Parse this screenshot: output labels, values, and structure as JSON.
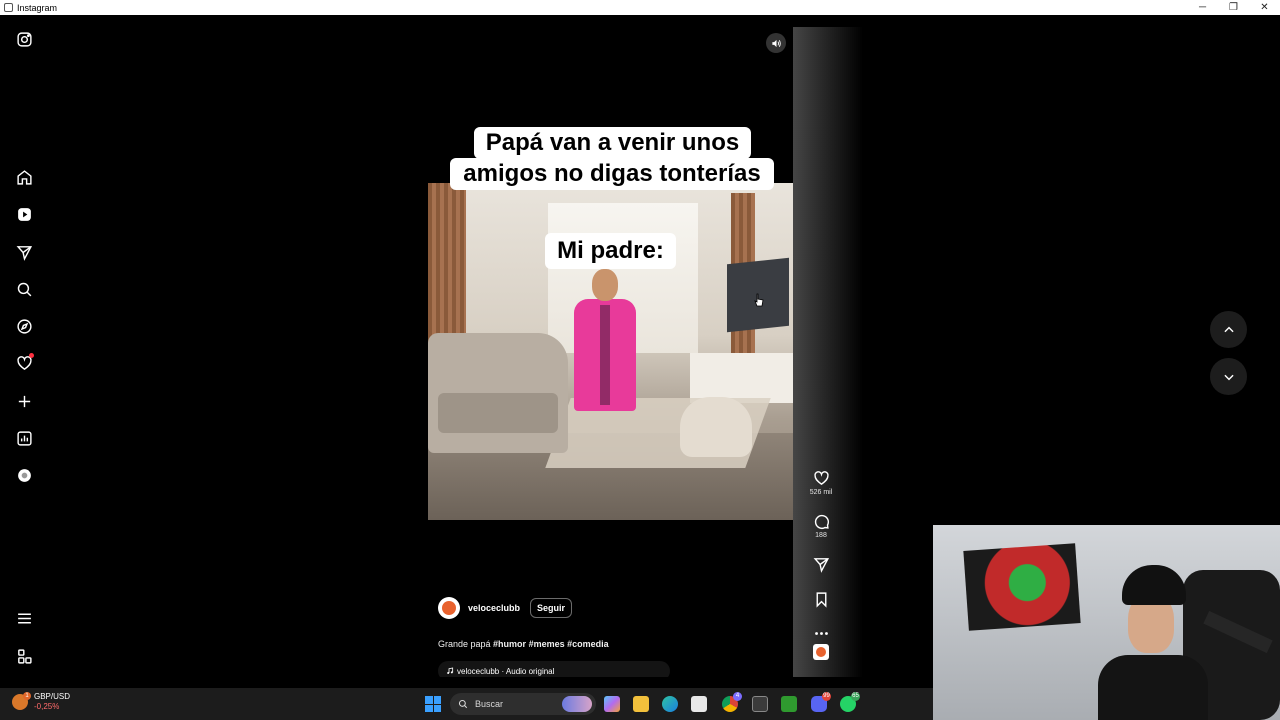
{
  "window": {
    "title": "Instagram",
    "controls": {
      "minimize": "─",
      "restore": "❐",
      "close": "✕"
    }
  },
  "sidebar": {
    "items": [
      {
        "name": "instagram-logo-icon"
      },
      {
        "name": "home-icon"
      },
      {
        "name": "reels-icon"
      },
      {
        "name": "messages-icon"
      },
      {
        "name": "search-icon"
      },
      {
        "name": "explore-icon"
      },
      {
        "name": "notifications-icon",
        "has_dot": true
      },
      {
        "name": "create-icon"
      },
      {
        "name": "dashboard-icon"
      },
      {
        "name": "meta-ai-icon"
      },
      {
        "name": "more-menu-icon"
      },
      {
        "name": "also-from-meta-icon"
      }
    ]
  },
  "reel": {
    "caption_line_1": "Papá van a venir unos",
    "caption_line_2": "amigos no digas tonterías",
    "caption_line_3": "Mi padre:",
    "author": "veloceclubb",
    "follow_label": "Seguir",
    "description_prefix": "Grande papá ",
    "hashtags": [
      "#humor",
      "#memes",
      "#comedia"
    ],
    "audio": "veloceclubb · Audio original"
  },
  "actions": {
    "likes": "526 mil",
    "comments": "188"
  },
  "taskbar": {
    "ticker_symbol": "GBP/USD",
    "ticker_change": "-0,25%",
    "ticker_badge": "1",
    "search_placeholder": "Buscar",
    "badges": {
      "app_a": "4",
      "discord": "99",
      "whatsapp": "65"
    }
  },
  "colors": {
    "background": "#000000",
    "notification_dot": "#ff3040",
    "accent_pink": "#e83a9a",
    "taskbar": "#1c1c1c"
  }
}
